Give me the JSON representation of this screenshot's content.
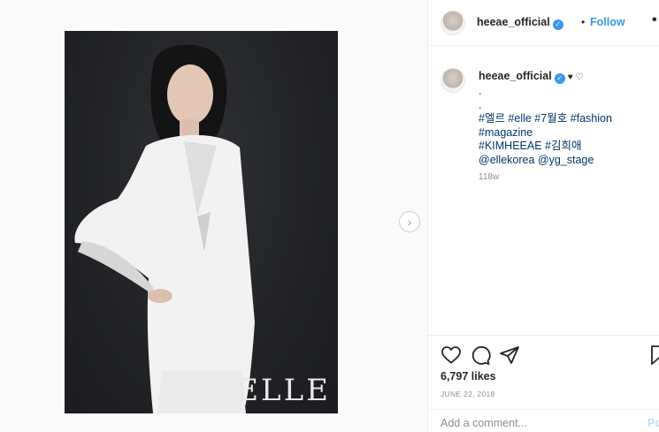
{
  "media": {
    "watermark": "ELLE",
    "next_icon": "chevron-right-icon"
  },
  "header": {
    "username": "heeae_official",
    "verified_icon": "verified-badge-icon",
    "separator": "•",
    "follow_label": "Follow",
    "more_icon": "more-options-icon",
    "more_glyph": "•"
  },
  "caption": {
    "username": "heeae_official",
    "hearts": "♥ ♡",
    "lines": [
      ".",
      "."
    ],
    "hashtags_line1": "#엘르 #elle #7월호 #fashion",
    "hashtags_line2": "#magazine",
    "hashtags_line3": "#KIMHEEAE #김희애",
    "mentions": "@ellekorea @yg_stage",
    "time_ago": "118w"
  },
  "actions": {
    "like_icon": "heart-icon",
    "comment_icon": "comment-icon",
    "share_icon": "share-icon",
    "save_icon": "bookmark-icon",
    "likes_text": "6,797 likes",
    "date": "JUNE 22, 2018"
  },
  "comment": {
    "placeholder": "Add a comment...",
    "post_label": "Post"
  },
  "colors": {
    "link_blue": "#3897f0",
    "hashtag_navy": "#003569",
    "muted_gray": "#8e8e8e",
    "border": "#efefef",
    "photo_bg": "#222326"
  }
}
